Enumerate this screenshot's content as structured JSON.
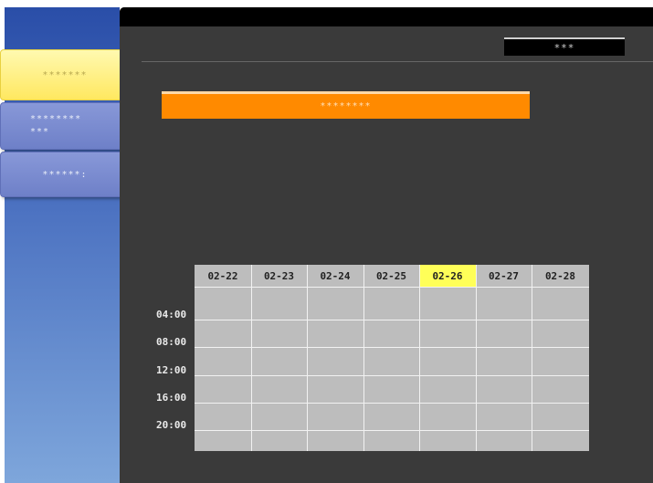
{
  "sidebar": {
    "items": [
      {
        "label": "*******",
        "active": true
      },
      {
        "label_line1": "********",
        "label_line2": "***",
        "active": false
      },
      {
        "label": "******:",
        "active": false
      }
    ]
  },
  "header": {
    "menu_button": "***"
  },
  "main": {
    "orange_bar_label": "********",
    "schedule": {
      "dates": [
        "02-22",
        "02-23",
        "02-24",
        "02-25",
        "02-26",
        "02-27",
        "02-28"
      ],
      "selected_date": "02-26",
      "times": [
        "04:00",
        "08:00",
        "12:00",
        "16:00",
        "20:00"
      ]
    }
  },
  "colors": {
    "selected_date": "#ffff58",
    "orange_bar": "#ff8a00",
    "active_tab": "#ffe860",
    "panel": "#3a3a3a"
  }
}
